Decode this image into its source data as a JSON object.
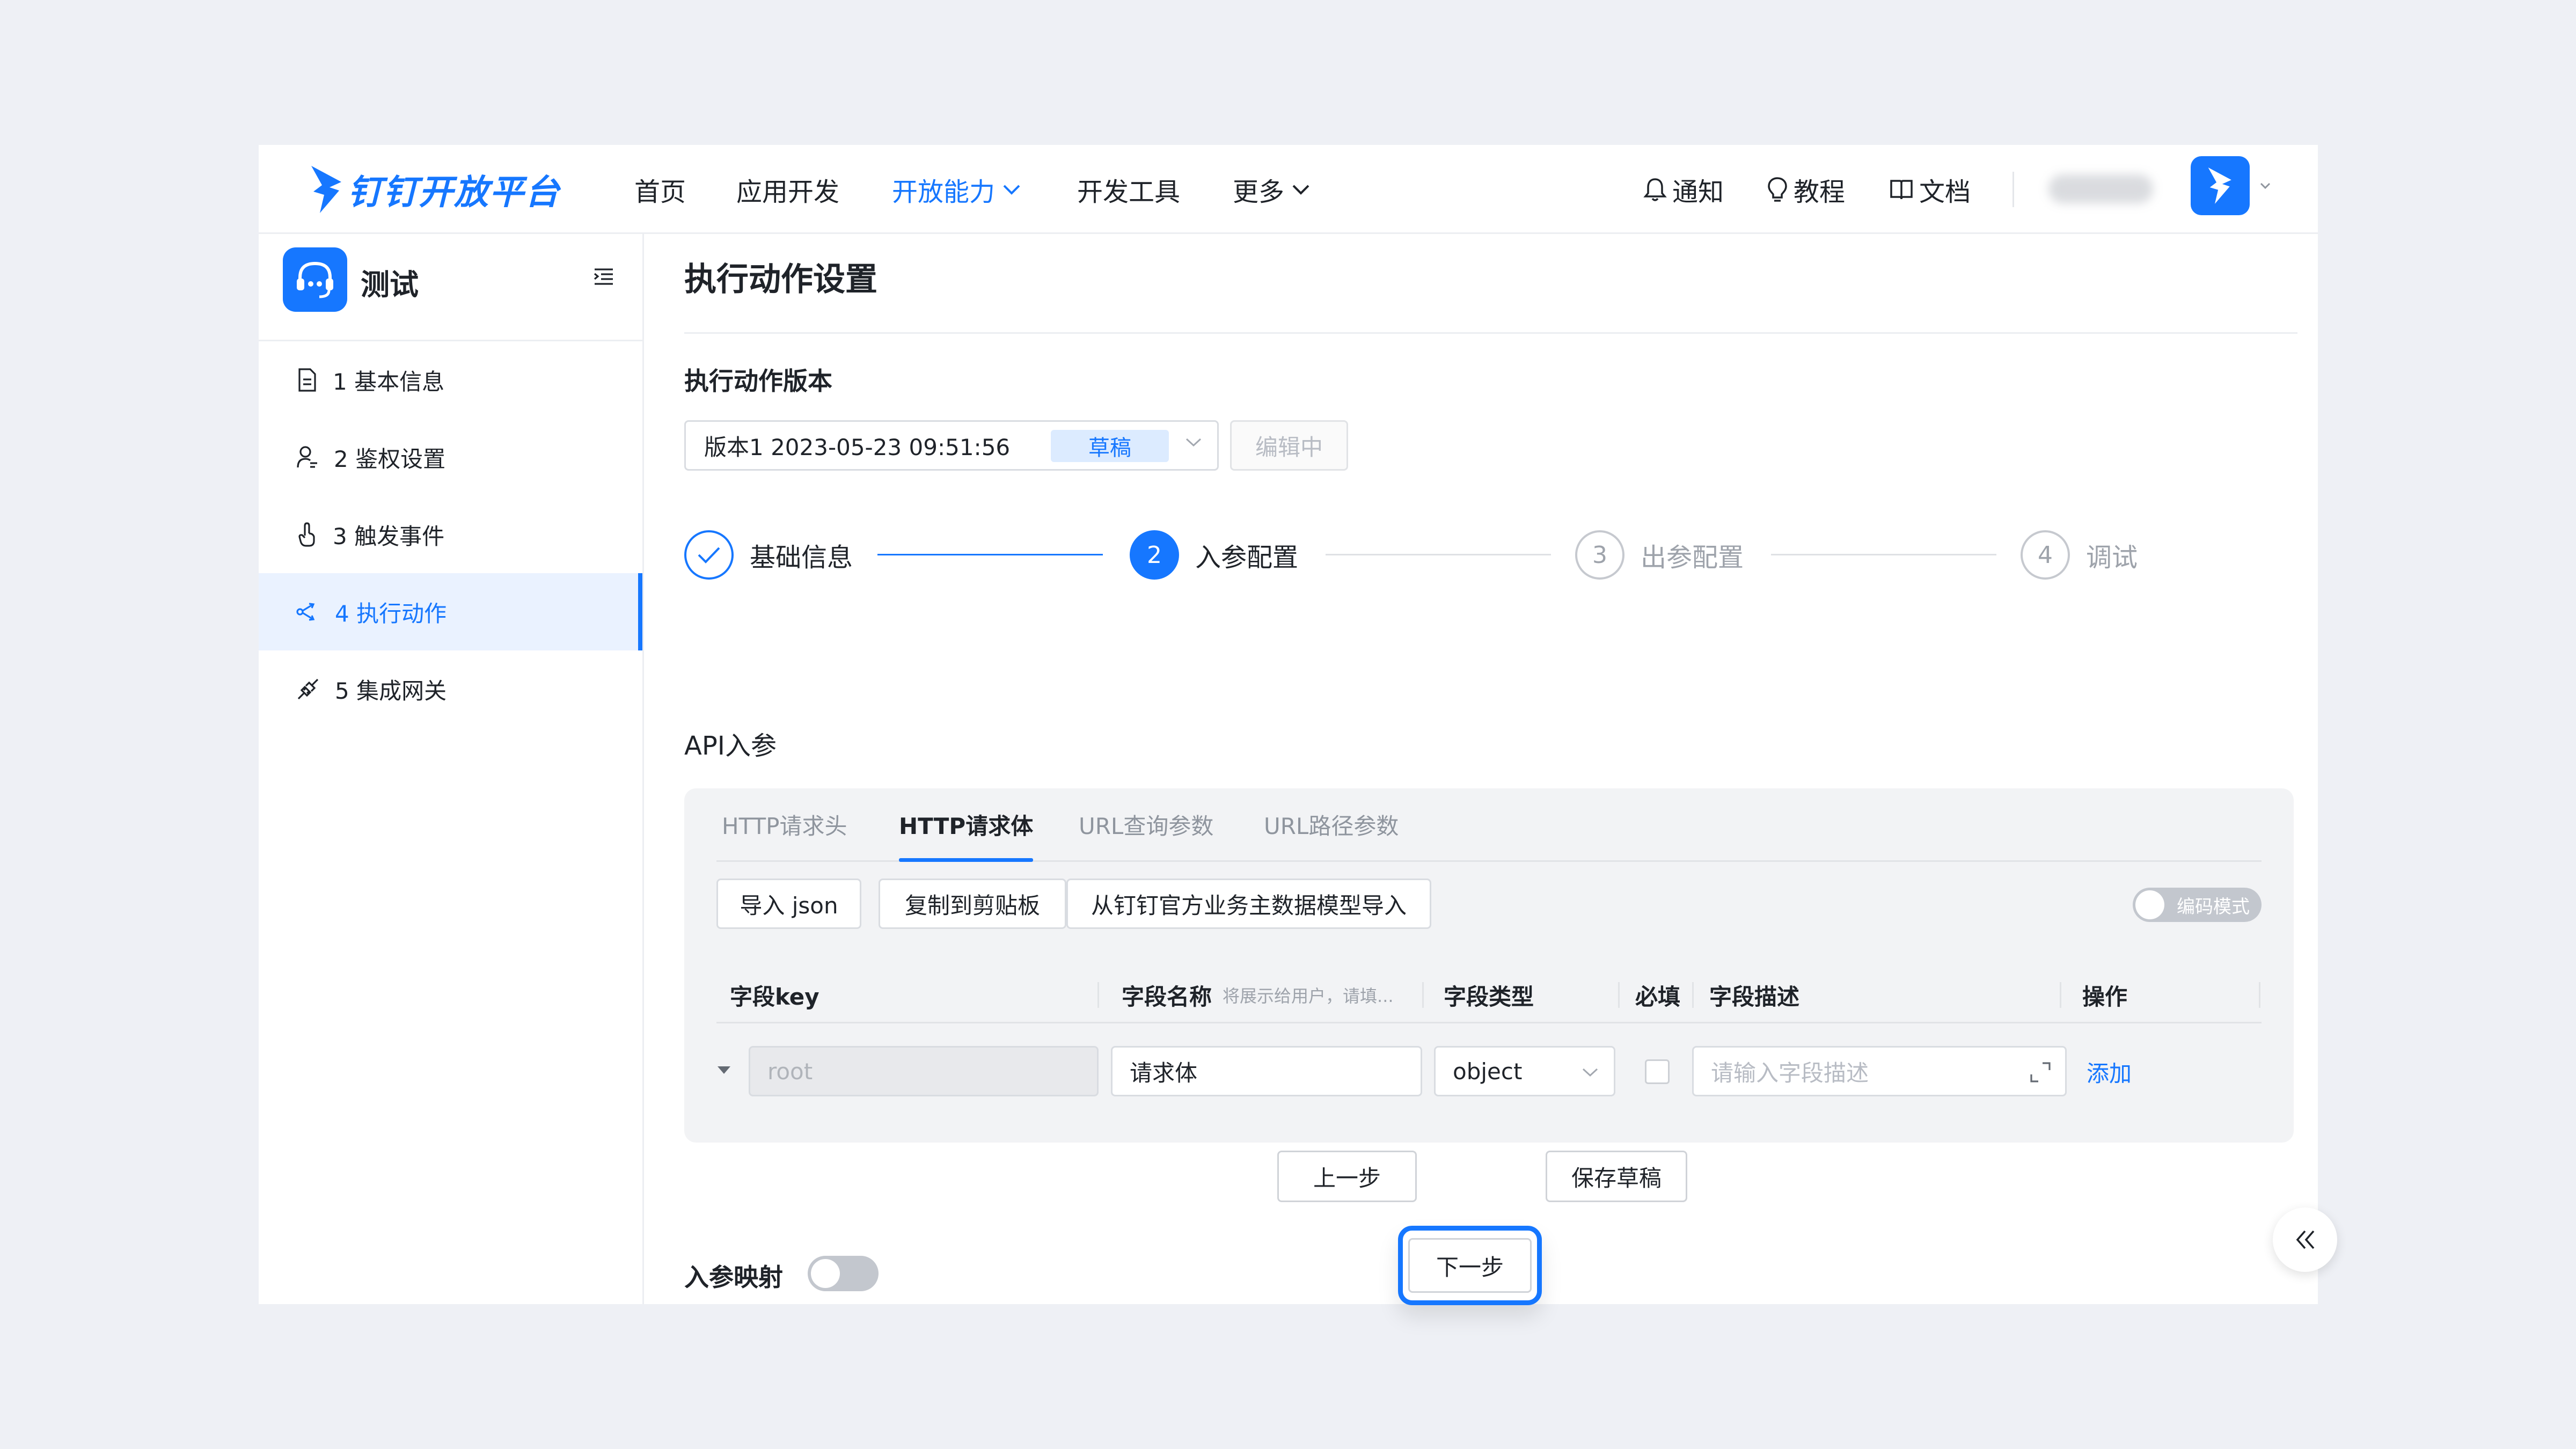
{
  "brand": {
    "name": "钉钉开放平台"
  },
  "nav": {
    "items": [
      {
        "label": "首页"
      },
      {
        "label": "应用开发"
      },
      {
        "label": "开放能力"
      },
      {
        "label": "开发工具"
      },
      {
        "label": "更多"
      }
    ],
    "active_index": 2
  },
  "utilities": {
    "notify": "通知",
    "tutorial": "教程",
    "docs": "文档"
  },
  "sidebar": {
    "app_name": "测试",
    "items": [
      {
        "label": "1 基本信息",
        "icon": "document-icon"
      },
      {
        "label": "2 鉴权设置",
        "icon": "user-key-icon"
      },
      {
        "label": "3 触发事件",
        "icon": "touch-icon"
      },
      {
        "label": "4 执行动作",
        "icon": "share-action-icon"
      },
      {
        "label": "5 集成网关",
        "icon": "link-gateway-icon"
      }
    ],
    "active_index": 3
  },
  "main": {
    "title": "执行动作设置",
    "version_label": "执行动作版本",
    "version": {
      "value": "版本1 2023-05-23 09:51:56",
      "badge": "草稿",
      "editing": "编辑中"
    },
    "steps": [
      {
        "num": "1",
        "label": "基础信息",
        "state": "done"
      },
      {
        "num": "2",
        "label": "入参配置",
        "state": "current"
      },
      {
        "num": "3",
        "label": "出参配置",
        "state": "pending"
      },
      {
        "num": "4",
        "label": "调试",
        "state": "pending"
      }
    ],
    "api_label": "API入参",
    "tabs": [
      {
        "label": "HTTP请求头"
      },
      {
        "label": "HTTP请求体"
      },
      {
        "label": "URL查询参数"
      },
      {
        "label": "URL路径参数"
      }
    ],
    "active_tab": 1,
    "actions": {
      "import_json": "导入 json",
      "copy": "复制到剪贴板",
      "import_model": "从钉钉官方业务主数据模型导入",
      "code_mode": "编码模式"
    },
    "table": {
      "headers": {
        "key": "字段key",
        "name": "字段名称",
        "name_hint": "将展示给用户，请填...",
        "type": "字段类型",
        "required": "必填",
        "desc": "字段描述",
        "op": "操作"
      },
      "rows": [
        {
          "key_placeholder": "root",
          "name": "请求体",
          "type": "object",
          "required": false,
          "desc_placeholder": "请输入字段描述",
          "op": "添加"
        }
      ]
    },
    "mapping_label": "入参映射",
    "mapping_enabled": false
  },
  "footer": {
    "prev": "上一步",
    "next": "下一步",
    "save": "保存草稿"
  },
  "colors": {
    "accent": "#1677ff",
    "page_bg": "#eef0f5",
    "panel_bg": "#f2f3f5"
  }
}
